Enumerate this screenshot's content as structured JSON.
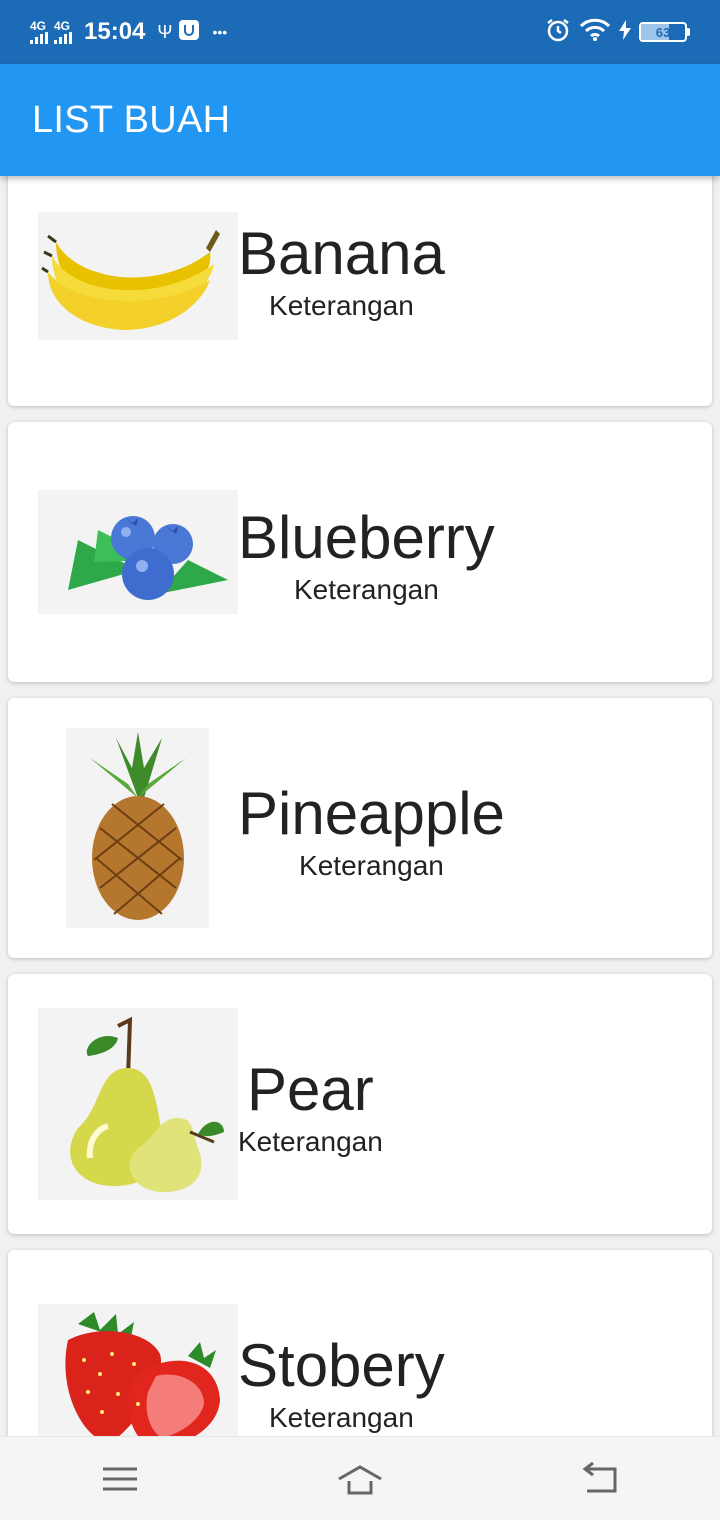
{
  "status_bar": {
    "network_1": "4G",
    "network_2": "4G",
    "time": "15:04",
    "usb_icon": "usb-icon",
    "more": "•••",
    "battery_level": "63"
  },
  "app_bar": {
    "title": "LIST BUAH"
  },
  "fruits": [
    {
      "name": "Banana",
      "description": "Keterangan",
      "icon": "banana-image"
    },
    {
      "name": "Blueberry",
      "description": "Keterangan",
      "icon": "blueberry-image"
    },
    {
      "name": "Pineapple",
      "description": "Keterangan",
      "icon": "pineapple-image"
    },
    {
      "name": "Pear",
      "description": "Keterangan",
      "icon": "pear-image"
    },
    {
      "name": "Stobery",
      "description": "Keterangan",
      "icon": "strawberry-image"
    }
  ],
  "nav_bar": {
    "menu_icon": "menu-icon",
    "home_icon": "home-icon",
    "back_icon": "back-icon"
  }
}
